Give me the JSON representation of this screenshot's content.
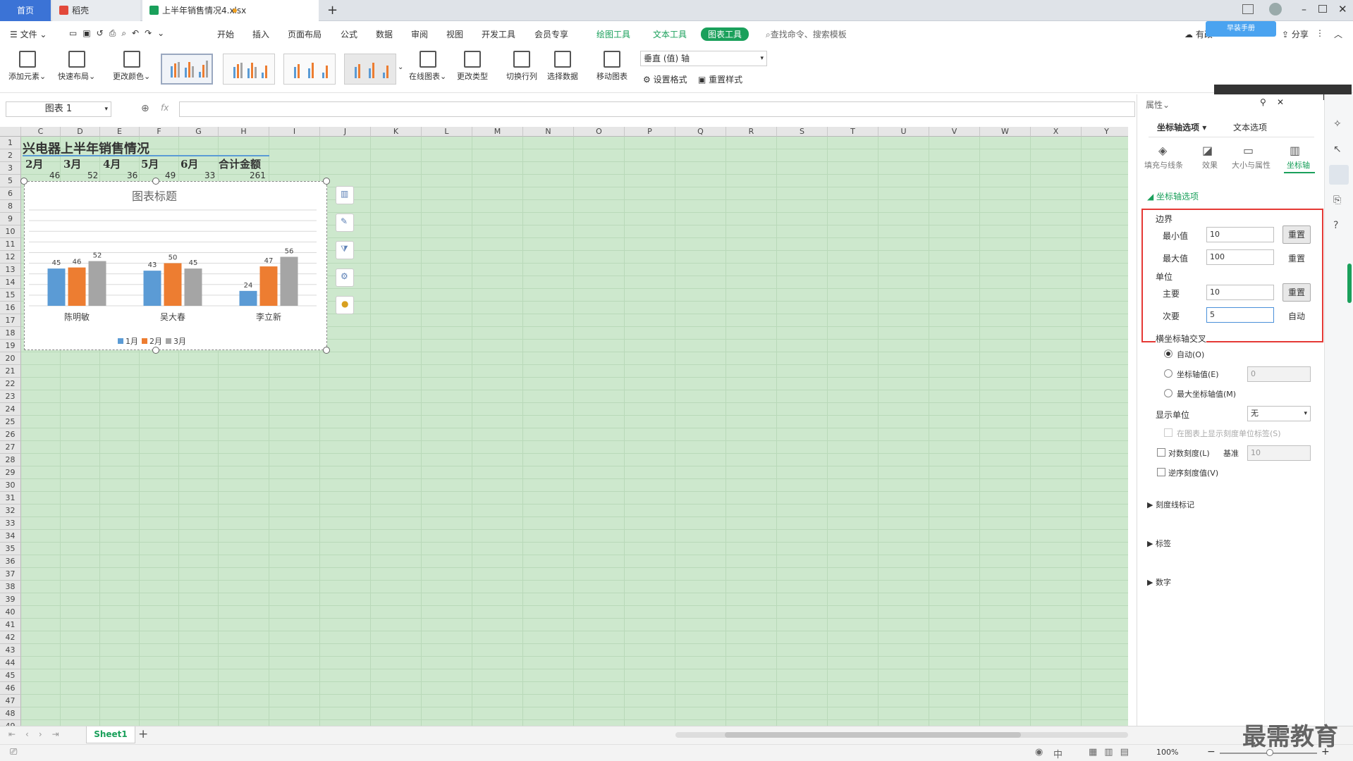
{
  "tabs": {
    "home": "首页",
    "doc": "稻壳",
    "active": "上半年销售情况4.xlsx",
    "new": "+"
  },
  "menu": {
    "file": "文件",
    "items": [
      "开始",
      "插入",
      "页面布局",
      "公式",
      "数据",
      "审阅",
      "视图",
      "开发工具",
      "会员专享"
    ],
    "draw": "绘图工具",
    "text": "文本工具",
    "chart": "图表工具",
    "search": "查找命令、搜索模板",
    "share": "分享",
    "sync": "有改",
    "baidu": "早装手册"
  },
  "ribbon": {
    "add_element": "添加元素",
    "quick_layout": "快速布局",
    "change_color": "更改颜色",
    "online_chart": "在线图表",
    "change_type": "更改类型",
    "switch_rowcol": "切换行列",
    "select_data": "选择数据",
    "move_chart": "移动图表",
    "axis_select": "垂直 (值) 轴",
    "set_format": "设置格式",
    "reset_style": "重置样式"
  },
  "formula": {
    "name_box": "图表 1",
    "fx": "fx"
  },
  "columns": [
    "C",
    "D",
    "E",
    "F",
    "G",
    "H",
    "I",
    "J",
    "K",
    "L",
    "M",
    "N",
    "O",
    "P",
    "Q",
    "R",
    "S",
    "T",
    "U",
    "V",
    "W",
    "X",
    "Y"
  ],
  "rows": [
    "1",
    "2",
    "3",
    "5",
    "6",
    "8",
    "9",
    "10",
    "11",
    "12",
    "13",
    "14",
    "15",
    "16",
    "17",
    "18",
    "19",
    "20",
    "21",
    "22",
    "23",
    "24",
    "25",
    "26",
    "27",
    "28",
    "29",
    "30",
    "31",
    "32",
    "33",
    "34",
    "35",
    "36",
    "37",
    "38",
    "39",
    "40",
    "41",
    "42",
    "43",
    "44",
    "45",
    "46",
    "47",
    "48",
    "49"
  ],
  "sheet_cells": {
    "title": "兴电器上半年销售情况",
    "headers": [
      "2月",
      "3月",
      "4月",
      "5月",
      "6月",
      "合计金额"
    ],
    "row3": [
      "46",
      "52",
      "36",
      "49",
      "33",
      "261"
    ]
  },
  "chart_data": {
    "type": "bar",
    "title": "图表标题",
    "categories": [
      "陈明敏",
      "吴大春",
      "李立新"
    ],
    "series": [
      {
        "name": "1月",
        "values": [
          45,
          43,
          24
        ],
        "color": "#5b9bd5"
      },
      {
        "name": "2月",
        "values": [
          46,
          50,
          47
        ],
        "color": "#ed7d31"
      },
      {
        "name": "3月",
        "values": [
          52,
          45,
          56
        ],
        "color": "#a5a5a5"
      }
    ],
    "ylim": [
      10,
      100
    ],
    "major_unit": 10,
    "legend": "bottom"
  },
  "panel": {
    "title": "属性",
    "tab_axis": "坐标轴选项",
    "tab_text": "文本选项",
    "sub_fill": "填充与线条",
    "sub_effect": "效果",
    "sub_size": "大小与属性",
    "sub_axis": "坐标轴",
    "section": "坐标轴选项",
    "bounds": "边界",
    "min_label": "最小值",
    "min_value": "10",
    "max_label": "最大值",
    "max_value": "100",
    "reset": "重置",
    "units": "单位",
    "major_label": "主要",
    "major_value": "10",
    "minor_label": "次要",
    "minor_value": "5",
    "auto": "自动",
    "cross": "横坐标轴交叉",
    "cross_auto": "自动(O)",
    "cross_value": "坐标轴值(E)",
    "cross_value_input": "0",
    "cross_max": "最大坐标轴值(M)",
    "display_unit": "显示单位",
    "display_unit_value": "无",
    "show_unit_label": "在图表上显示刻度单位标签(S)",
    "log_scale": "对数刻度(L)",
    "base": "基准",
    "base_value": "10",
    "reverse": "逆序刻度值(V)",
    "tick_marks": "刻度线标记",
    "labels": "标签",
    "number": "数字"
  },
  "sheet": {
    "name": "Sheet1"
  },
  "status": {
    "zoom": "100%"
  },
  "watermark": "最需教育"
}
